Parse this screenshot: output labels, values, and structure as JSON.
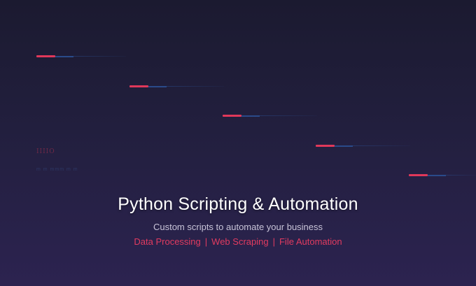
{
  "hero": {
    "title": "Python Scripting & Automation",
    "subtitle": "Custom scripts to automate your business",
    "services": [
      "Data Processing",
      "Web Scraping",
      "File Automation"
    ],
    "separator": "|"
  },
  "decor": {
    "mark_text": "IIIIO",
    "sub_text": "m m mmm m m"
  },
  "colors": {
    "accent": "#e0385a",
    "line_blue": "#2a4a8a",
    "background_top": "#1b1a30",
    "background_bottom": "#2c2350"
  }
}
